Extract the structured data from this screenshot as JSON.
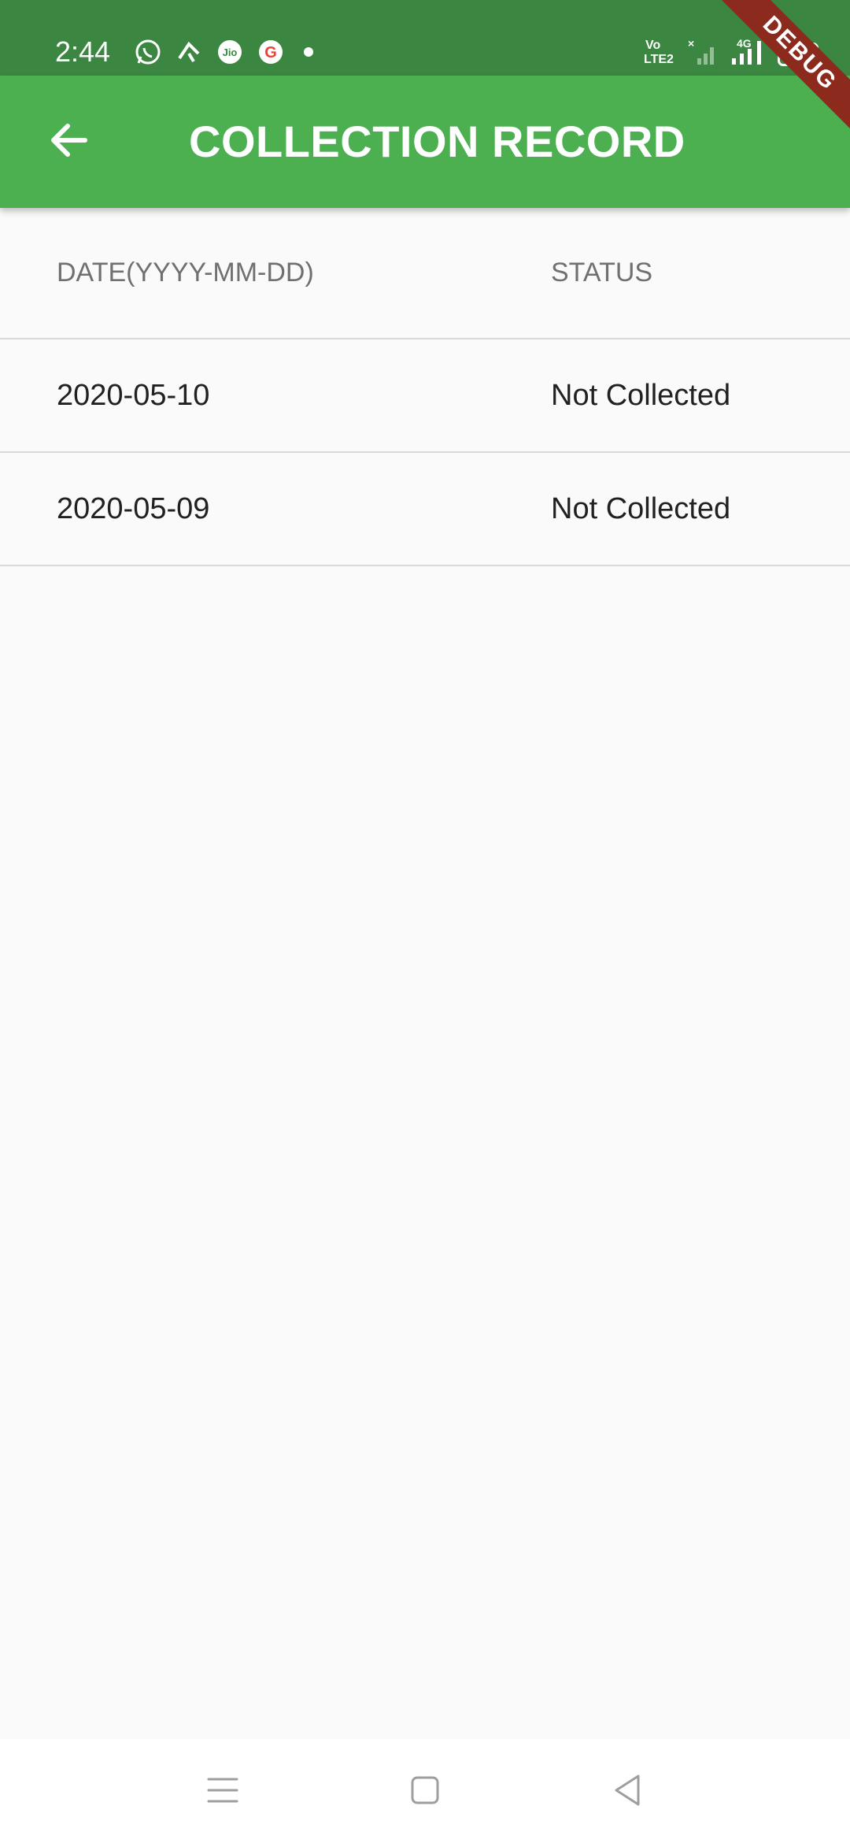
{
  "status_bar": {
    "time": "2:44",
    "battery": "35",
    "network": "4G",
    "volte": "VoLTE2",
    "icons_left": [
      "whatsapp-icon",
      "sync-icon",
      "jio-icon",
      "google-icon",
      "dot-icon"
    ],
    "icons_right": [
      "volte-icon",
      "signal-sim1-icon",
      "signal-sim2-icon",
      "battery-icon"
    ]
  },
  "app_bar": {
    "title": "COLLECTION RECORD",
    "back_icon": "arrow-back-icon",
    "background": "#4caf50"
  },
  "debug_banner": "DEBUG",
  "table": {
    "columns": [
      "DATE(YYYY-MM-DD)",
      "STATUS"
    ],
    "rows": [
      {
        "date": "2020-05-10",
        "status": "Not Collected"
      },
      {
        "date": "2020-05-09",
        "status": "Not Collected"
      }
    ]
  },
  "nav_bar": {
    "icons": [
      "menu-icon",
      "home-icon",
      "back-icon"
    ]
  },
  "colors": {
    "status_bar": "#3b8741",
    "app_bar": "#4caf50",
    "background": "#fafafa",
    "debug_banner": "#8b2a1d",
    "header_text": "#707070",
    "row_text": "#212121"
  }
}
